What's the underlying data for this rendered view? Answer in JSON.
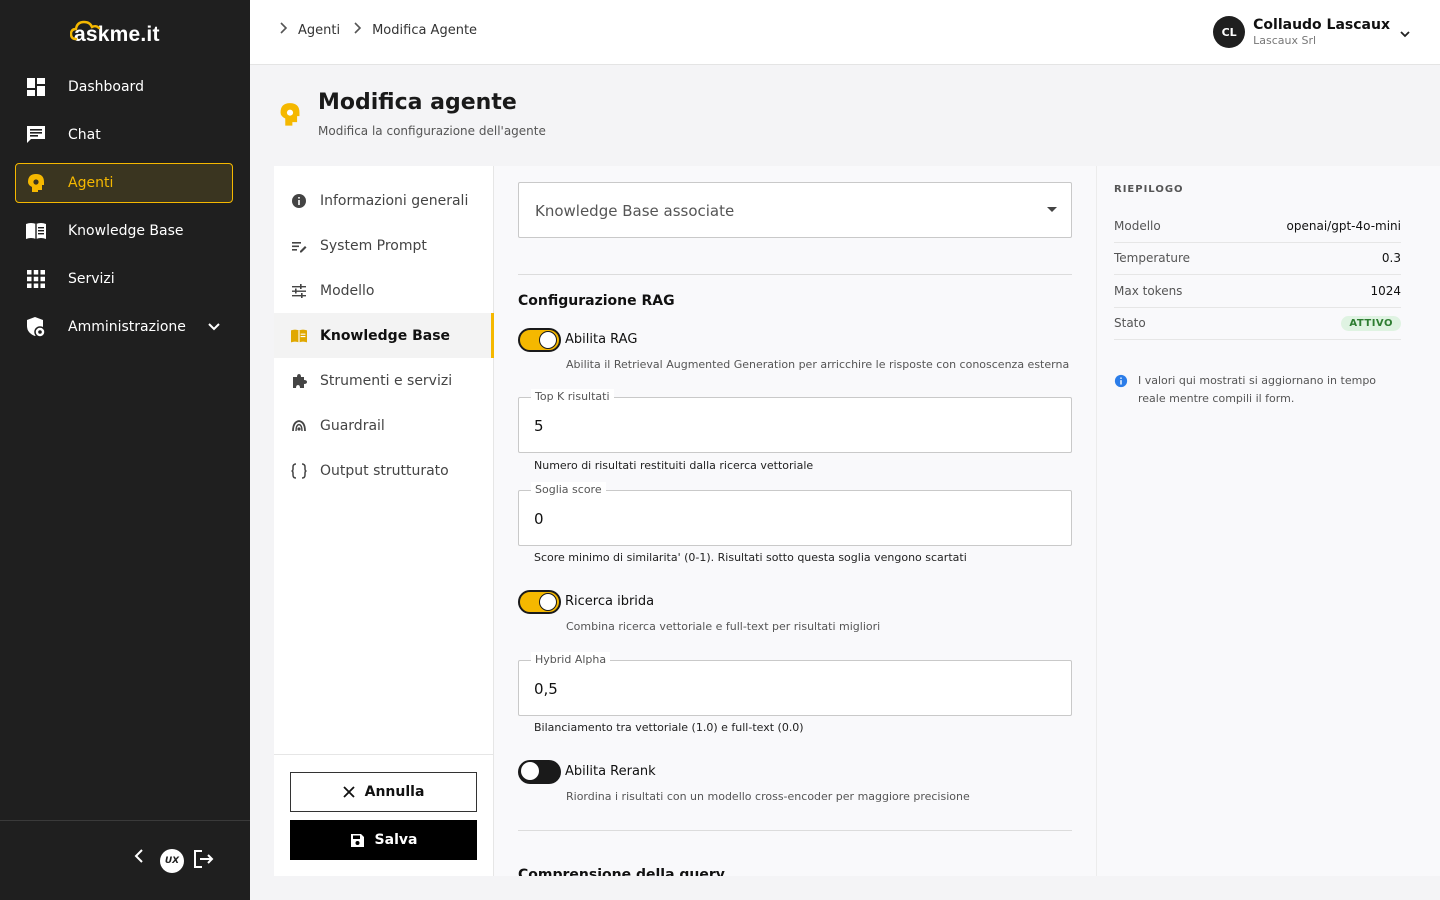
{
  "brand": {
    "name": "askme.it"
  },
  "sidebar": {
    "items": [
      {
        "label": "Dashboard",
        "icon": "dashboard-icon"
      },
      {
        "label": "Chat",
        "icon": "chat-icon"
      },
      {
        "label": "Agenti",
        "icon": "agent-icon",
        "active": true
      },
      {
        "label": "Knowledge Base",
        "icon": "book-icon"
      },
      {
        "label": "Servizi",
        "icon": "grid-icon"
      },
      {
        "label": "Amministrazione",
        "icon": "admin-shield-icon",
        "expandable": true
      }
    ],
    "footer_logo": "UX"
  },
  "header": {
    "breadcrumbs": [
      "Agenti",
      "Modifica Agente"
    ],
    "user": {
      "initials": "CL",
      "name": "Collaudo Lascaux",
      "org": "Lascaux Srl"
    }
  },
  "page": {
    "title": "Modifica agente",
    "subtitle": "Modifica la configurazione dell'agente"
  },
  "tabs": [
    {
      "label": "Informazioni generali",
      "icon": "info-icon"
    },
    {
      "label": "System Prompt",
      "icon": "prompt-icon"
    },
    {
      "label": "Modello",
      "icon": "tune-icon"
    },
    {
      "label": "Knowledge Base",
      "icon": "book-icon",
      "active": true
    },
    {
      "label": "Strumenti e servizi",
      "icon": "puzzle-icon"
    },
    {
      "label": "Guardrail",
      "icon": "guardrail-icon"
    },
    {
      "label": "Output strutturato",
      "icon": "braces-icon"
    }
  ],
  "actions": {
    "cancel": "Annulla",
    "save": "Salva"
  },
  "form": {
    "kb_select": {
      "label": "Knowledge Base associate"
    },
    "rag_section": "Configurazione RAG",
    "enable_rag": {
      "label": "Abilita RAG",
      "help": "Abilita il Retrieval Augmented Generation per arricchire le risposte con conoscenza esterna",
      "on": true
    },
    "top_k": {
      "label": "Top K risultati",
      "value": "5",
      "help": "Numero di risultati restituiti dalla ricerca vettoriale"
    },
    "score": {
      "label": "Soglia score",
      "value": "0",
      "help": "Score minimo di similarita' (0-1). Risultati sotto questa soglia vengono scartati"
    },
    "hybrid": {
      "label": "Ricerca ibrida",
      "help": "Combina ricerca vettoriale e full-text per risultati migliori",
      "on": true
    },
    "alpha": {
      "label": "Hybrid Alpha",
      "value": "0,5",
      "help": "Bilanciamento tra vettoriale (1.0) e full-text (0.0)"
    },
    "rerank": {
      "label": "Abilita Rerank",
      "help": "Riordina i risultati con un modello cross-encoder per maggiore precisione",
      "on": false
    },
    "next_section": "Comprensione della query"
  },
  "summary": {
    "title": "RIEPILOGO",
    "rows": [
      {
        "key": "Modello",
        "value": "openai/gpt-4o-mini"
      },
      {
        "key": "Temperature",
        "value": "0.3"
      },
      {
        "key": "Max tokens",
        "value": "1024"
      },
      {
        "key": "Stato",
        "value": "ATTIVO"
      }
    ],
    "note": "I valori qui mostrati si aggiornano in tempo reale mentre compili il form."
  },
  "colors": {
    "accent": "#f5b800",
    "sidebar": "#1f1f1f",
    "success": "#2e7d32"
  }
}
